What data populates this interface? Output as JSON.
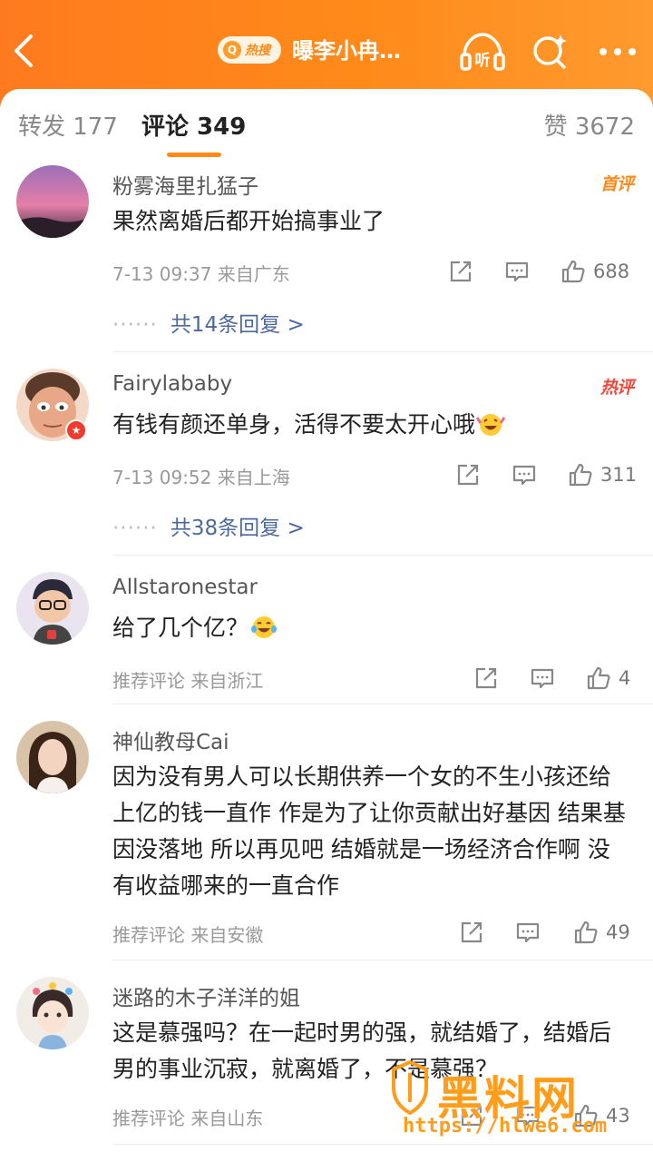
{
  "header": {
    "hot_label": "热搜",
    "title": "曝李小冉…",
    "icons": [
      "back-icon",
      "listen-icon",
      "search-icon",
      "more-icon"
    ]
  },
  "tabs": {
    "repost": "转发 177",
    "comments": "评论 349",
    "likes": "赞 3672"
  },
  "comments": [
    {
      "username": "粉雾海里扎猛子",
      "tag": "首评",
      "text": "果然离婚后都开始搞事业了",
      "meta": "7-13 09:37  来自广东",
      "likes": "688",
      "replies": "共14条回复 >"
    },
    {
      "username": "Fairylababy",
      "tag": "热评",
      "text": "有钱有颜还单身，活得不要太开心哦",
      "meta": "7-13 09:52  来自上海",
      "likes": "311",
      "replies": "共38条回复 >"
    },
    {
      "username": "Allstaronestar",
      "text": "给了几个亿？",
      "meta": "推荐评论  来自浙江",
      "likes": "4"
    },
    {
      "username": "神仙教母Cai",
      "text": "因为没有男人可以长期供养一个女的不生小孩还给上亿的钱一直作 作是为了让你贡献出好基因 结果基因没落地 所以再见吧 结婚就是一场经济合作啊 没有收益哪来的一直合作",
      "meta": "推荐评论  来自安徽",
      "likes": "49"
    },
    {
      "username": "迷路的木子洋洋的姐",
      "text": "这是慕强吗？在一起时男的强，就结婚了，结婚后男的事业沉寂，就离婚了，不是慕强？",
      "meta": "推荐评论  来自山东",
      "likes": "43"
    }
  ],
  "watermark": {
    "logo": "黑料网",
    "url": "https://hlwe6.com"
  },
  "colors": {
    "header_orange": "#ff8a1a",
    "link_blue": "#4d6aa0",
    "hot_red": "#f14a3c"
  }
}
